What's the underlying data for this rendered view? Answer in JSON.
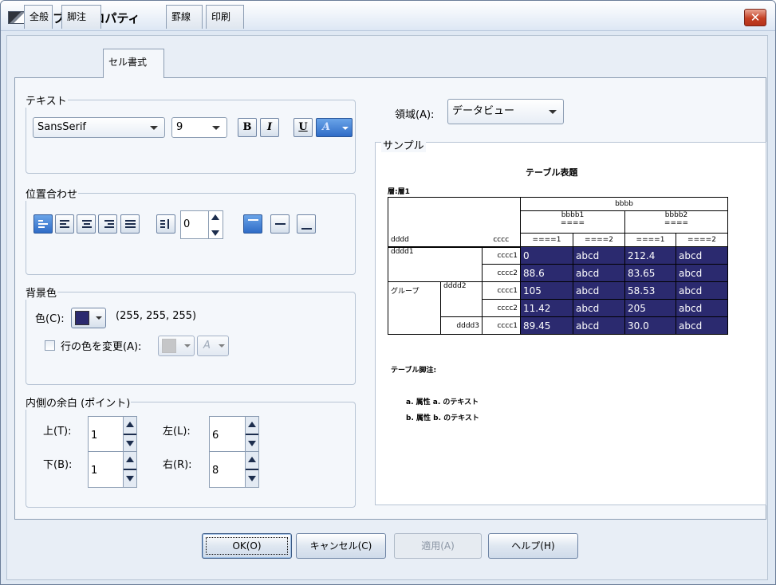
{
  "window": {
    "title": "テーブル プロパティ",
    "close_glyph": "✕"
  },
  "tabs": [
    {
      "label": "全般"
    },
    {
      "label": "脚注"
    },
    {
      "label": "セル書式",
      "active": true
    },
    {
      "label": "罫線"
    },
    {
      "label": "印刷"
    }
  ],
  "text_group": {
    "legend": "テキスト",
    "font": "SansSerif",
    "size": "9",
    "bold": "B",
    "italic": "I",
    "underline": "U",
    "color_glyph": "A"
  },
  "align_group": {
    "legend": "位置合わせ",
    "indent_value": "0"
  },
  "bg_group": {
    "legend": "背景色",
    "color_label": "色(C):",
    "color_swatch": "#2b2a6f",
    "rgb_text": "(255, 255, 255)",
    "alt_row_label": "行の色を変更(A):",
    "alt_glyph": "A"
  },
  "margin_group": {
    "legend": "内側の余白 (ポイント)",
    "top_label": "上(T):",
    "top_value": "1",
    "bottom_label": "下(B):",
    "bottom_value": "1",
    "left_label": "左(L):",
    "left_value": "6",
    "right_label": "右(R):",
    "right_value": "8"
  },
  "region": {
    "label": "領域(A):",
    "value": "データビュー"
  },
  "sample": {
    "legend": "サンプル",
    "table_title": "テーブル表題",
    "layer": "層:層1",
    "top_header": "bbbb",
    "sub_header1": "bbbb1",
    "sub_header2": "bbbb2",
    "sub_dash": "====",
    "dim_row": "dddd",
    "dim_col": "cccc",
    "col_a1": "====1",
    "col_a2": "====2",
    "col_b1": "====1",
    "col_b2": "====2",
    "group_label": "グループ",
    "row_d1": "dddd1",
    "row_d2": "dddd2",
    "row_d3": "dddd3",
    "row_c1": "cccc1",
    "row_c2": "cccc2",
    "v": [
      "0",
      "abcd",
      "212.4",
      "abcd",
      "88.6",
      "abcd",
      "83.65",
      "abcd",
      "105",
      "abcd",
      "58.53",
      "abcd",
      "11.42",
      "abcd",
      "205",
      "abcd",
      "89.45",
      "abcd",
      "30.0",
      "abcd"
    ],
    "caption": "テーブル脚注:",
    "foot_a": "a. 属性 a. のテキスト",
    "foot_b": "b. 属性 b. のテキスト"
  },
  "buttons": {
    "ok": "OK(O)",
    "cancel": "キャンセル(C)",
    "apply": "適用(A)",
    "help": "ヘルプ(H)"
  },
  "colors": {
    "cell_dark": "#2b2a6f",
    "accent_blue": "#2f6cc7"
  }
}
